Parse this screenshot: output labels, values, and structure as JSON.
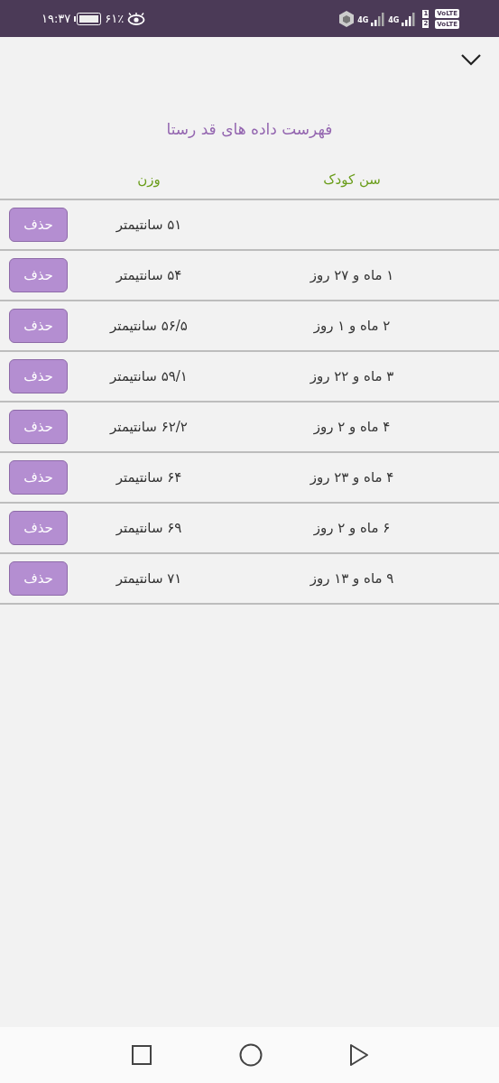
{
  "status_bar": {
    "time": "۱۹:۳۷",
    "battery": "۶۱٪",
    "network_1": "4G",
    "network_2": "4G",
    "sim_1": "1",
    "sim_2": "2",
    "volte_1": "VoLTE",
    "volte_2": "VoLTE"
  },
  "title": "فهرست داده های قد رستا",
  "table": {
    "columns": [
      "سن کودک",
      "وزن"
    ],
    "rows": [
      {
        "age": "",
        "value": "۵۱ سانتیمتر",
        "button": "حذف"
      },
      {
        "age": "۱ ماه و ۲۷ روز",
        "value": "۵۴ سانتیمتر",
        "button": "حذف"
      },
      {
        "age": "۲ ماه و ۱ روز",
        "value": "۵۶/۵ سانتیمتر",
        "button": "حذف"
      },
      {
        "age": "۳ ماه و ۲۲ روز",
        "value": "۵۹/۱ سانتیمتر",
        "button": "حذف"
      },
      {
        "age": "۴ ماه و ۲ روز",
        "value": "۶۲/۲ سانتیمتر",
        "button": "حذف"
      },
      {
        "age": "۴ ماه و ۲۳ روز",
        "value": "۶۴ سانتیمتر",
        "button": "حذف"
      },
      {
        "age": "۶ ماه و ۲ روز",
        "value": "۶۹ سانتیمتر",
        "button": "حذف"
      },
      {
        "age": "۹ ماه و ۱۳ روز",
        "value": "۷۱ سانتیمتر",
        "button": "حذف"
      }
    ]
  }
}
